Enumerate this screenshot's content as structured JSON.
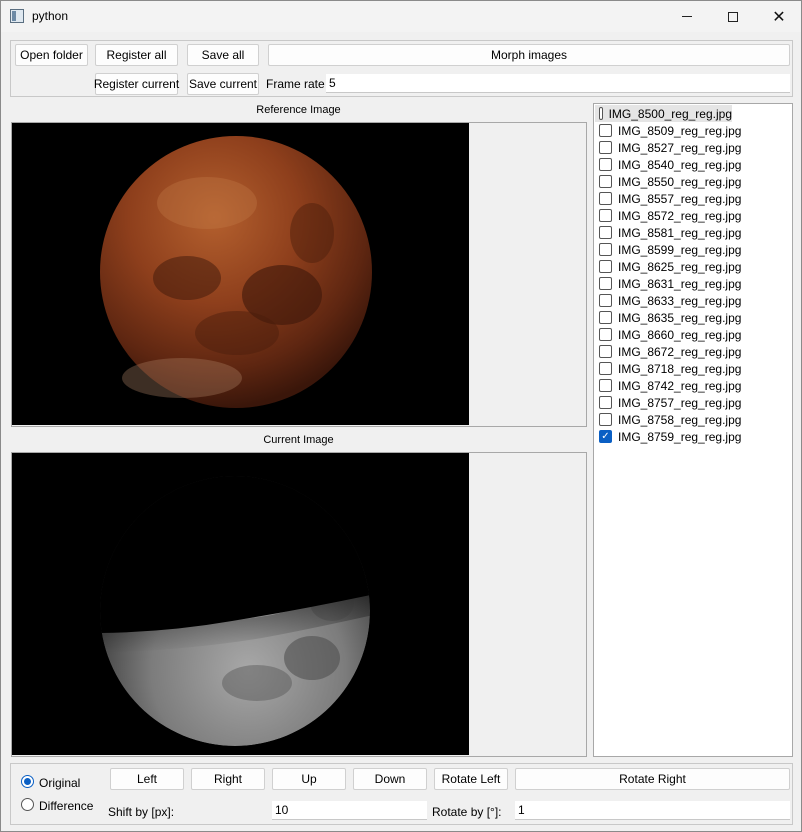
{
  "window": {
    "title": "python",
    "minimize_glyph": "minimize-icon",
    "maximize_glyph": "maximize-icon",
    "close_glyph": "✕"
  },
  "toolbar": {
    "open_folder": "Open folder",
    "register_all": "Register all",
    "save_all": "Save all",
    "morph_images": "Morph images",
    "register_current": "Register current",
    "save_current": "Save current",
    "frame_rate_label": "Frame rate",
    "frame_rate_value": "5"
  },
  "panels": {
    "reference_title": "Reference Image",
    "current_title": "Current Image"
  },
  "files": [
    {
      "name": "IMG_8500_reg_reg.jpg",
      "checked": false,
      "selected": true
    },
    {
      "name": "IMG_8509_reg_reg.jpg",
      "checked": false
    },
    {
      "name": "IMG_8527_reg_reg.jpg",
      "checked": false
    },
    {
      "name": "IMG_8540_reg_reg.jpg",
      "checked": false
    },
    {
      "name": "IMG_8550_reg_reg.jpg",
      "checked": false
    },
    {
      "name": "IMG_8557_reg_reg.jpg",
      "checked": false
    },
    {
      "name": "IMG_8572_reg_reg.jpg",
      "checked": false
    },
    {
      "name": "IMG_8581_reg_reg.jpg",
      "checked": false
    },
    {
      "name": "IMG_8599_reg_reg.jpg",
      "checked": false
    },
    {
      "name": "IMG_8625_reg_reg.jpg",
      "checked": false
    },
    {
      "name": "IMG_8631_reg_reg.jpg",
      "checked": false
    },
    {
      "name": "IMG_8633_reg_reg.jpg",
      "checked": false
    },
    {
      "name": "IMG_8635_reg_reg.jpg",
      "checked": false
    },
    {
      "name": "IMG_8660_reg_reg.jpg",
      "checked": false
    },
    {
      "name": "IMG_8672_reg_reg.jpg",
      "checked": false
    },
    {
      "name": "IMG_8718_reg_reg.jpg",
      "checked": false
    },
    {
      "name": "IMG_8742_reg_reg.jpg",
      "checked": false
    },
    {
      "name": "IMG_8757_reg_reg.jpg",
      "checked": false
    },
    {
      "name": "IMG_8758_reg_reg.jpg",
      "checked": false
    },
    {
      "name": "IMG_8759_reg_reg.jpg",
      "checked": true
    }
  ],
  "bottom": {
    "original_label": "Original",
    "difference_label": "Difference",
    "left": "Left",
    "right": "Right",
    "up": "Up",
    "down": "Down",
    "rotate_left": "Rotate Left",
    "rotate_right": "Rotate Right",
    "shift_label": "Shift by [px]:",
    "shift_value": "10",
    "rotate_label": "Rotate by [°]:",
    "rotate_value": "1"
  },
  "colors": {
    "accent": "#0a5fc4",
    "moon_red": "#7a3518",
    "moon_grey": "#9a9a9a"
  }
}
